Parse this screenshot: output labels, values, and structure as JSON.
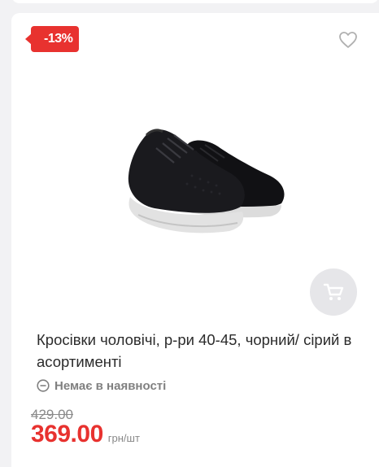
{
  "product": {
    "discount_badge": "-13%",
    "title": "Кросівки чоловічі, р-ри 40-45, чорний/ сірий в асортименті",
    "availability": "Немає в наявності",
    "old_price": "429.00",
    "price": "369.00",
    "price_unit": "грн/шт"
  },
  "icons": {
    "favorite": "heart-icon",
    "cart": "cart-icon",
    "availability": "minus-circle-icon"
  },
  "colors": {
    "accent": "#e8322f",
    "muted": "#808080",
    "cart_bg": "#e6e6e9"
  }
}
